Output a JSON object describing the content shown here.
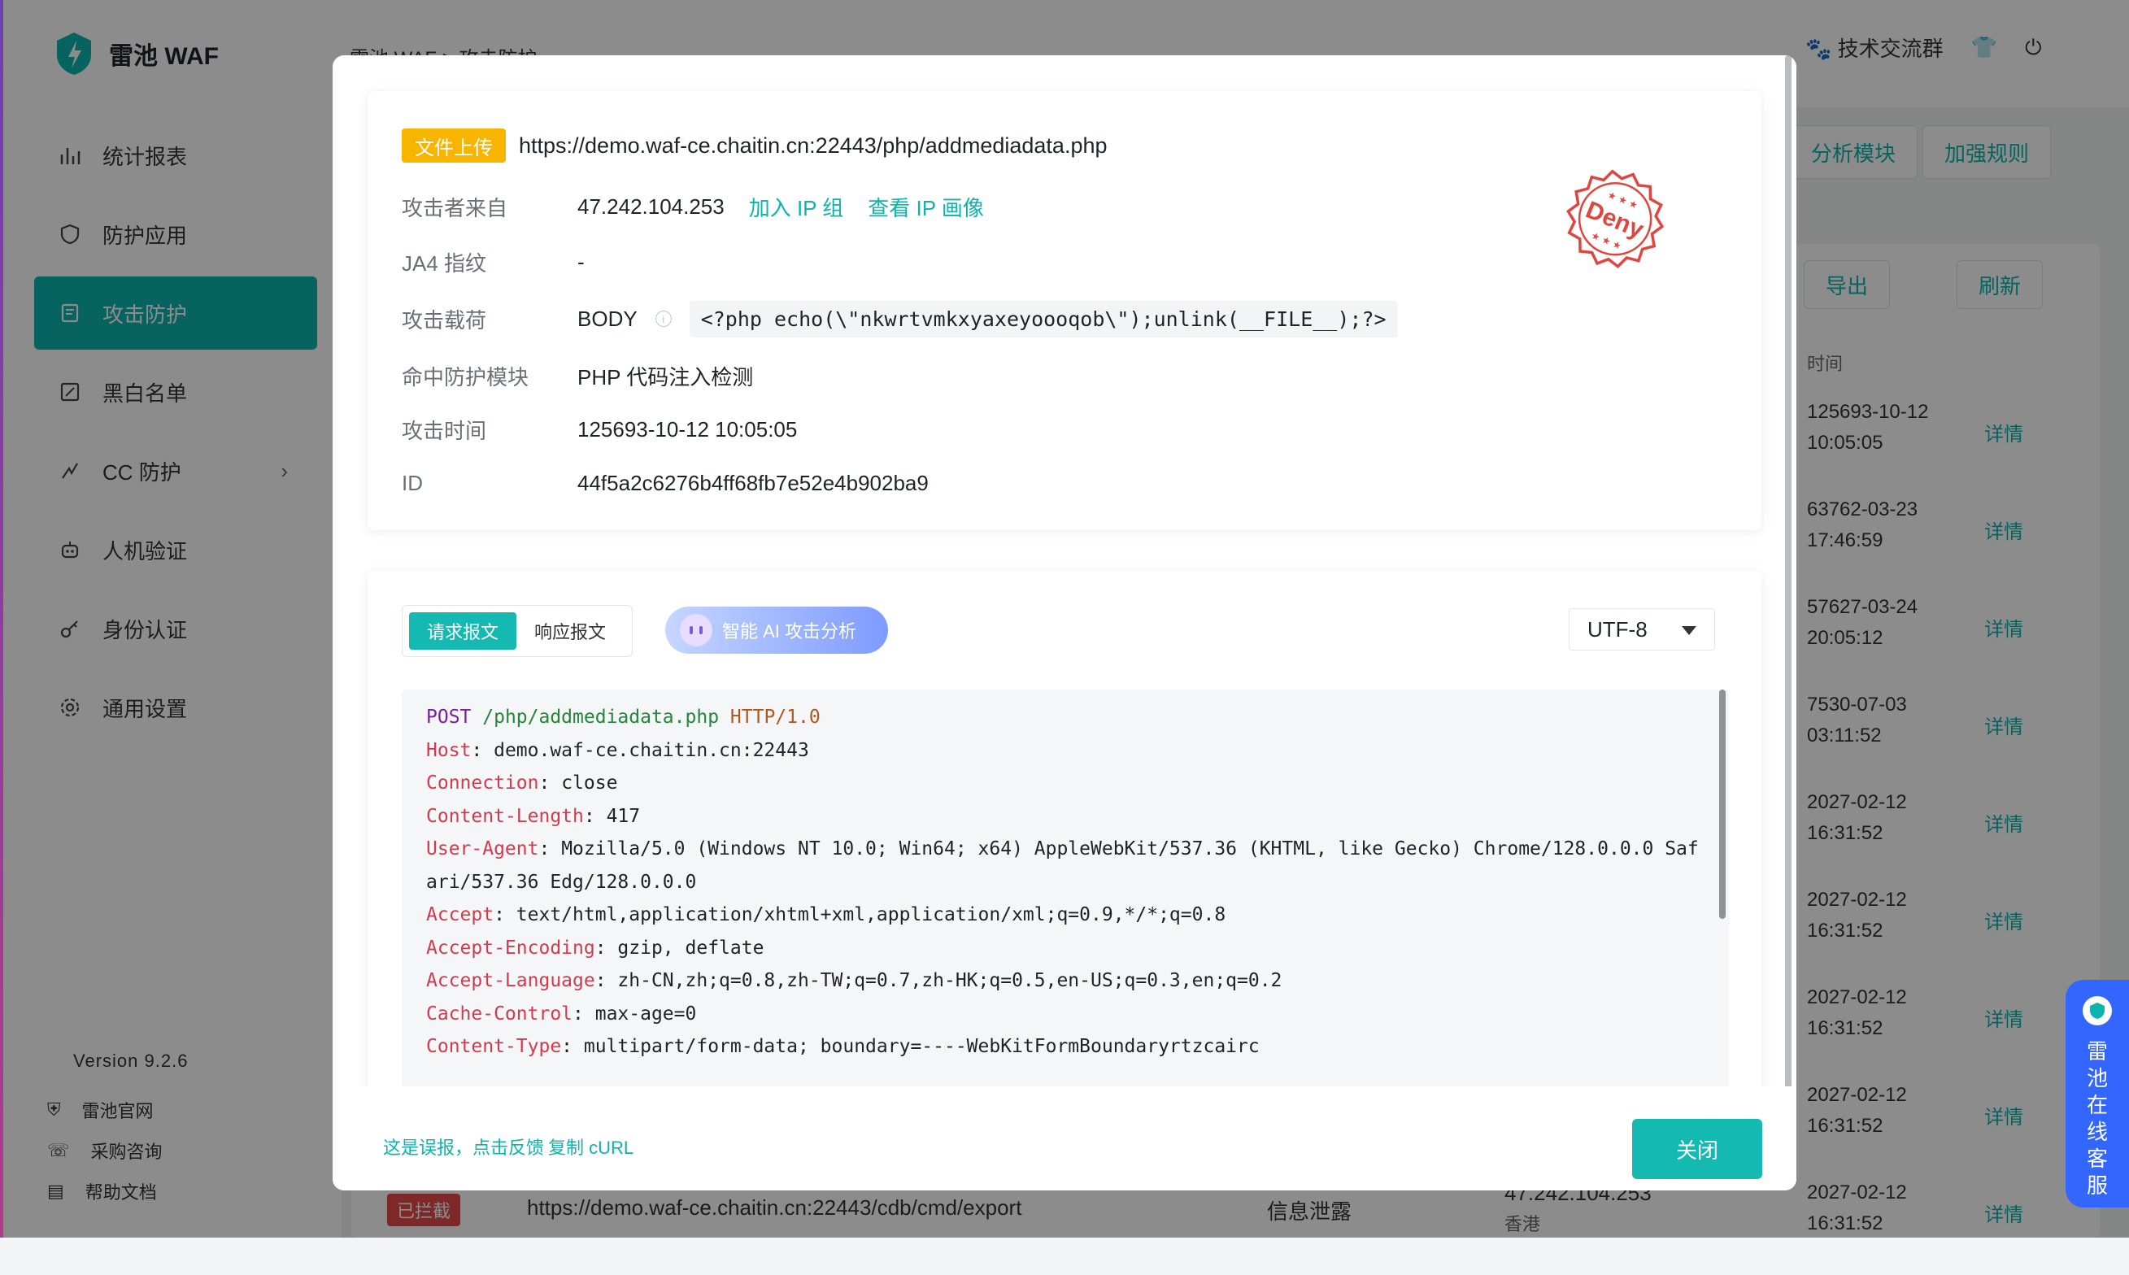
{
  "app": {
    "logo_text": "雷池 WAF",
    "version": "Version 9.2.6",
    "breadcrumb": "雷池 WAF  >  攻击防护",
    "nav": [
      {
        "label": "统计报表"
      },
      {
        "label": "防护应用"
      },
      {
        "label": "攻击防护"
      },
      {
        "label": "黑白名单"
      },
      {
        "label": "CC 防护"
      },
      {
        "label": "人机验证"
      },
      {
        "label": "身份认证"
      },
      {
        "label": "通用设置"
      }
    ],
    "links": [
      {
        "label": "雷池官网"
      },
      {
        "label": "采购咨询"
      },
      {
        "label": "帮助文档"
      }
    ],
    "topbar": {
      "community": "技术交流群"
    },
    "toolbar": {
      "analysis_module": "分析模块",
      "strengthen_rules": "加强规则",
      "export": "导出",
      "refresh": "刷新"
    },
    "table": {
      "time_header": "时间",
      "detail_label": "详情",
      "rows": [
        {
          "time": "125693-10-12\n10:05:05"
        },
        {
          "time": "63762-03-23\n17:46:59"
        },
        {
          "time": "57627-03-24\n20:05:12"
        },
        {
          "time": "7530-07-03\n03:11:52"
        },
        {
          "time": "2027-02-12\n16:31:52"
        },
        {
          "time": "2027-02-12\n16:31:52"
        },
        {
          "time": "2027-02-12\n16:31:52"
        },
        {
          "time": "2027-02-12\n16:31:52"
        },
        {
          "time": "2027-02-12\n16:31:52"
        }
      ],
      "bottom_row": {
        "status": "已拦截",
        "url": "https://demo.waf-ce.chaitin.cn:22443/cdb/cmd/export",
        "type": "信息泄露",
        "ip": "47.242.104.253",
        "region": "香港"
      }
    },
    "support_text": "雷池在线客服"
  },
  "modal": {
    "tag": "文件上传",
    "url": "https://demo.waf-ce.chaitin.cn:22443/php/addmediadata.php",
    "attacker": {
      "label": "攻击者来自",
      "ip": "47.242.104.253",
      "add_ip_group": "加入 IP 组",
      "view_ip_profile": "查看 IP 画像"
    },
    "ja4": {
      "label": "JA4 指纹",
      "value": "-"
    },
    "payload": {
      "label": "攻击载荷",
      "location": "BODY",
      "value": "<?php echo(\\\"nkwrtvmkxyaxeyoooqob\\\");unlink(__FILE__);?>"
    },
    "module": {
      "label": "命中防护模块",
      "value": "PHP 代码注入检测"
    },
    "attack_time": {
      "label": "攻击时间",
      "value": "125693-10-12 10:05:05"
    },
    "id": {
      "label": "ID",
      "value": "44f5a2c6276b4ff68fb7e52e4b902ba9"
    },
    "stamp_text": "Deny",
    "tabs": {
      "request": "请求报文",
      "response": "响应报文"
    },
    "ai_button": "智能 AI 攻击分析",
    "encoding": "UTF-8",
    "request": {
      "method": "POST",
      "path": "/php/addmediadata.php",
      "protocol": "HTTP/1.0",
      "headers": [
        {
          "name": "Host",
          "value": "demo.waf-ce.chaitin.cn:22443"
        },
        {
          "name": "Connection",
          "value": "close"
        },
        {
          "name": "Content-Length",
          "value": "417"
        },
        {
          "name": "User-Agent",
          "value": "Mozilla/5.0 (Windows NT 10.0; Win64; x64) AppleWebKit/537.36 (KHTML, like Gecko) Chrome/128.0.0.0 Safari/537.36 Edg/128.0.0.0"
        },
        {
          "name": "Accept",
          "value": "text/html,application/xhtml+xml,application/xml;q=0.9,*/*;q=0.8"
        },
        {
          "name": "Accept-Encoding",
          "value": "gzip, deflate"
        },
        {
          "name": "Accept-Language",
          "value": "zh-CN,zh;q=0.8,zh-TW;q=0.7,zh-HK;q=0.5,en-US;q=0.3,en;q=0.2"
        },
        {
          "name": "Cache-Control",
          "value": "max-age=0"
        },
        {
          "name": "Content-Type",
          "value": "multipart/form-data; boundary=----WebKitFormBoundaryrtzcairc"
        }
      ]
    },
    "footer": {
      "false_positive": "这是误报，点击反馈",
      "copy_curl": "复制 cURL",
      "close": "关闭"
    }
  },
  "colors": {
    "accent": "#14b9b2",
    "tag": "#f8b500",
    "stamp": "#e0453f",
    "support": "#3366ff"
  }
}
